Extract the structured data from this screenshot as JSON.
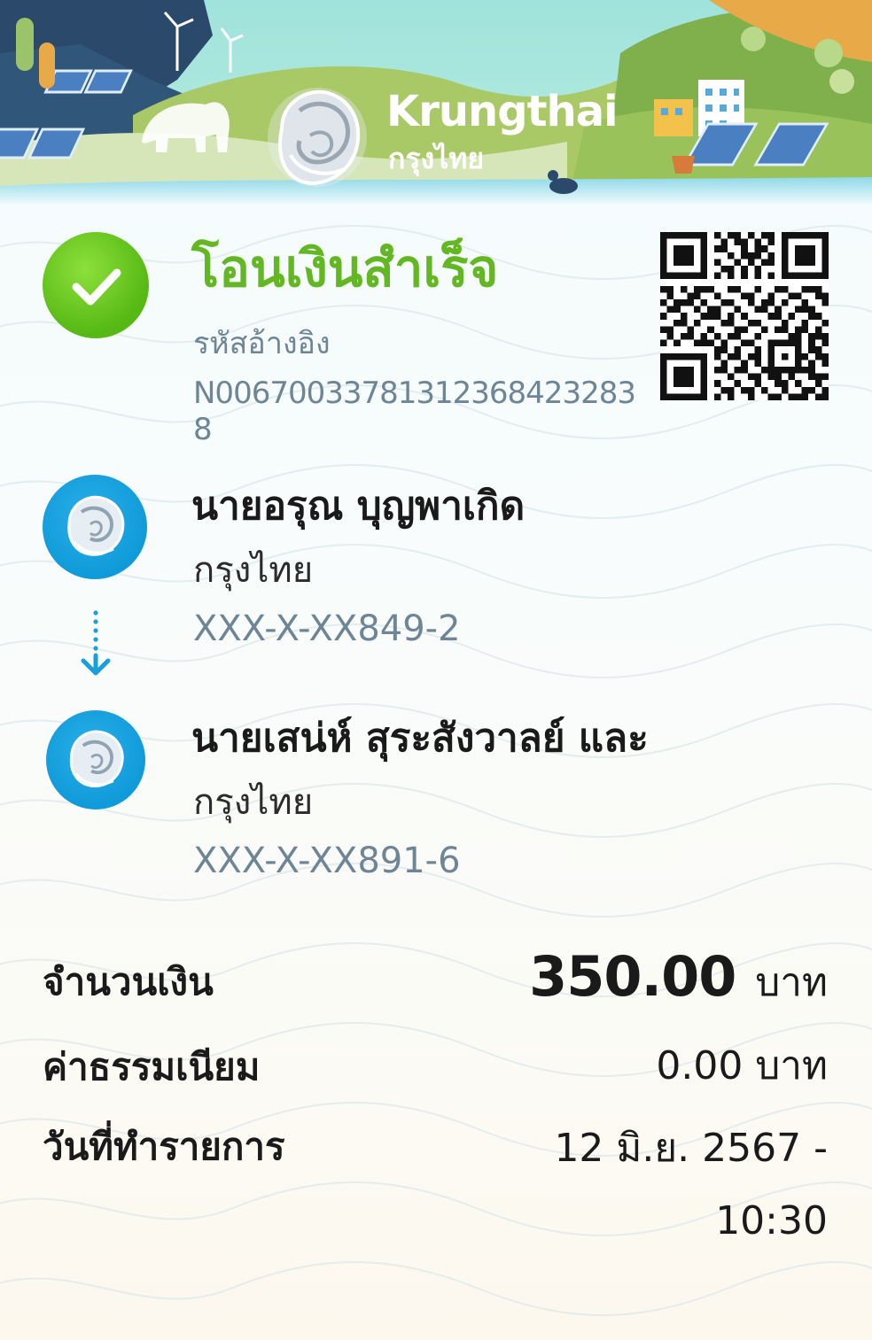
{
  "brand": {
    "name_en": "Krungthai",
    "name_th": "กรุงไทย",
    "logo_icon": "garuda-phoenix-logo"
  },
  "status": {
    "title": "โอนเงินสำเร็จ",
    "icon": "check-circle-icon",
    "color": "#63b722",
    "reference_label": "รหัสอ้างอิง",
    "reference_code": "N006700337813123684232838"
  },
  "qr": {
    "icon": "qr-code"
  },
  "sender": {
    "name": "นายอรุณ บุญพาเกิด",
    "bank": "กรุงไทย",
    "account": "XXX-X-XX849-2",
    "logo_icon": "krungthai-bank-logo"
  },
  "receiver": {
    "name": "นายเสน่ห์ สุระสังวาลย์ และ",
    "bank": "กรุงไทย",
    "account": "XXX-X-XX891-6",
    "logo_icon": "krungthai-bank-logo"
  },
  "summary": {
    "amount_label": "จำนวนเงิน",
    "amount_value": "350.00",
    "amount_unit": "บาท",
    "fee_label": "ค่าธรรมเนียม",
    "fee_value": "0.00 บาท",
    "date_label": "วันที่ทำรายการ",
    "date_value": "12 มิ.ย. 2567 - 10:30"
  },
  "colors": {
    "accent_green": "#63b722",
    "bank_blue": "#0f9ad9",
    "muted_text": "#6e8596"
  }
}
